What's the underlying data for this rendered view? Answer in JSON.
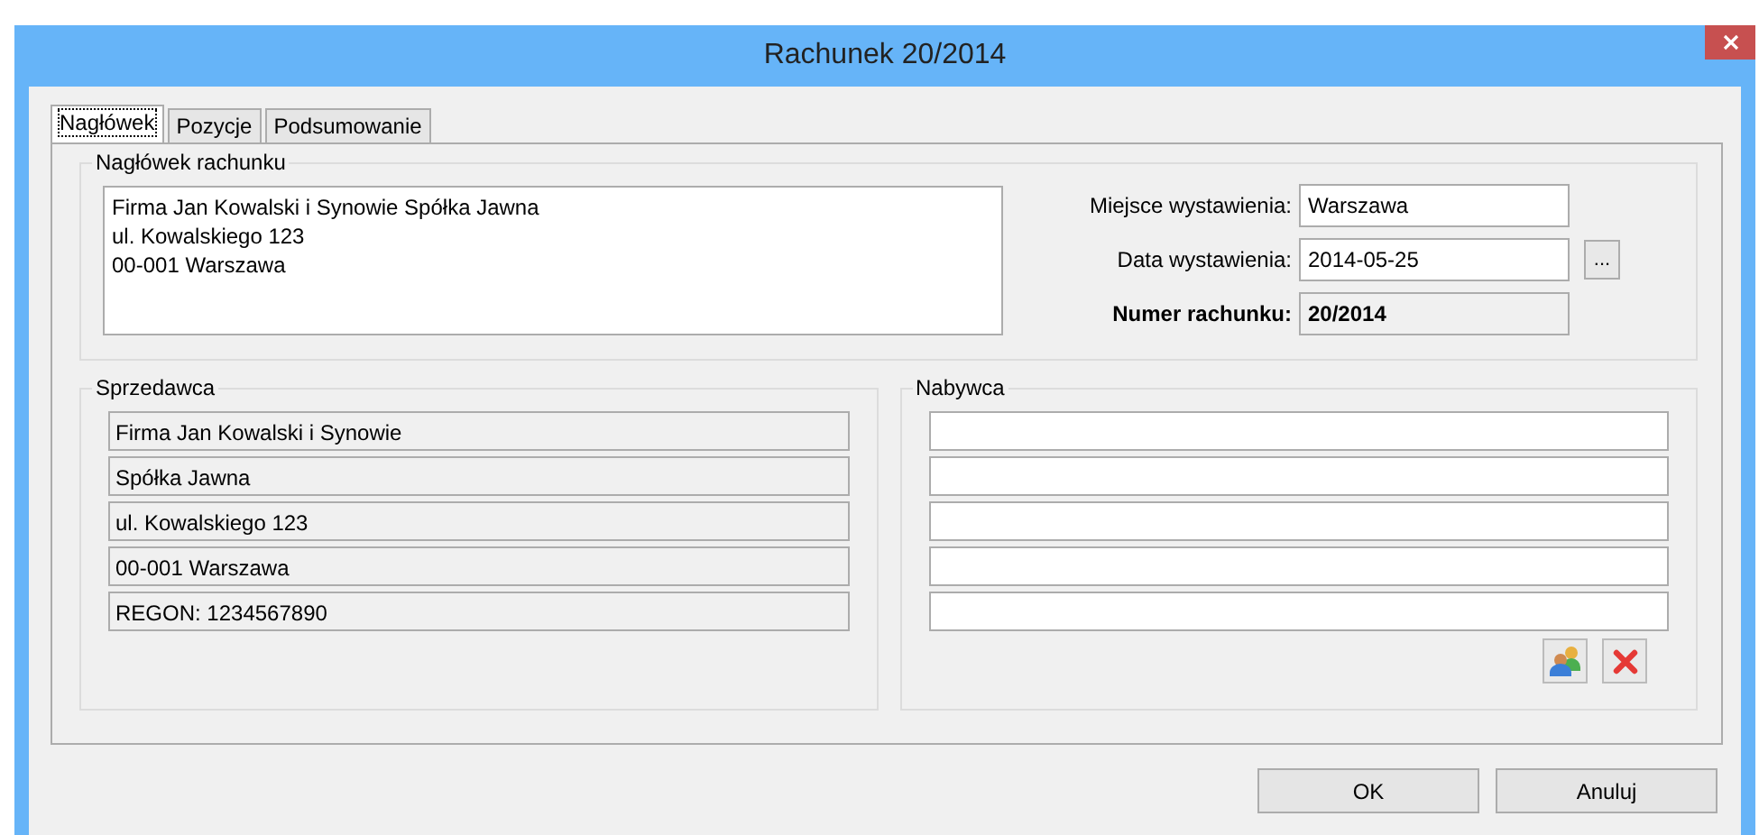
{
  "window": {
    "title": "Rachunek 20/2014"
  },
  "tabs": [
    {
      "label": "Nagłówek",
      "selected": true
    },
    {
      "label": "Pozycje",
      "selected": false
    },
    {
      "label": "Podsumowanie",
      "selected": false
    }
  ],
  "header": {
    "title": "Nagłówek rachunku",
    "address": "Firma Jan Kowalski i Synowie Spółka Jawna\nul. Kowalskiego 123\n00-001 Warszawa",
    "fields": [
      {
        "label": "Miejsce wystawienia:",
        "value": "Warszawa",
        "editable": true,
        "bold": false
      },
      {
        "label": "Data wystawienia:",
        "value": "2014-05-25",
        "editable": true,
        "bold": false,
        "picker_button": "..."
      },
      {
        "label": "Numer rachunku:",
        "value": "20/2014",
        "editable": false,
        "bold": true
      }
    ]
  },
  "seller": {
    "title": "Sprzedawca",
    "lines": [
      {
        "text": "Firma Jan Kowalski i Synowie",
        "editable": false
      },
      {
        "text": "Spółka Jawna",
        "editable": false
      },
      {
        "text": "ul. Kowalskiego 123",
        "editable": false
      },
      {
        "text": "00-001 Warszawa",
        "editable": false
      },
      {
        "text": "REGON: 1234567890",
        "editable": false
      }
    ]
  },
  "buyer": {
    "title": "Nabywca",
    "lines": [
      {
        "editable": true
      },
      {
        "editable": true
      },
      {
        "editable": true
      },
      {
        "editable": true
      },
      {
        "editable": true
      }
    ]
  },
  "buttons": [
    "OK",
    "Anuluj"
  ]
}
